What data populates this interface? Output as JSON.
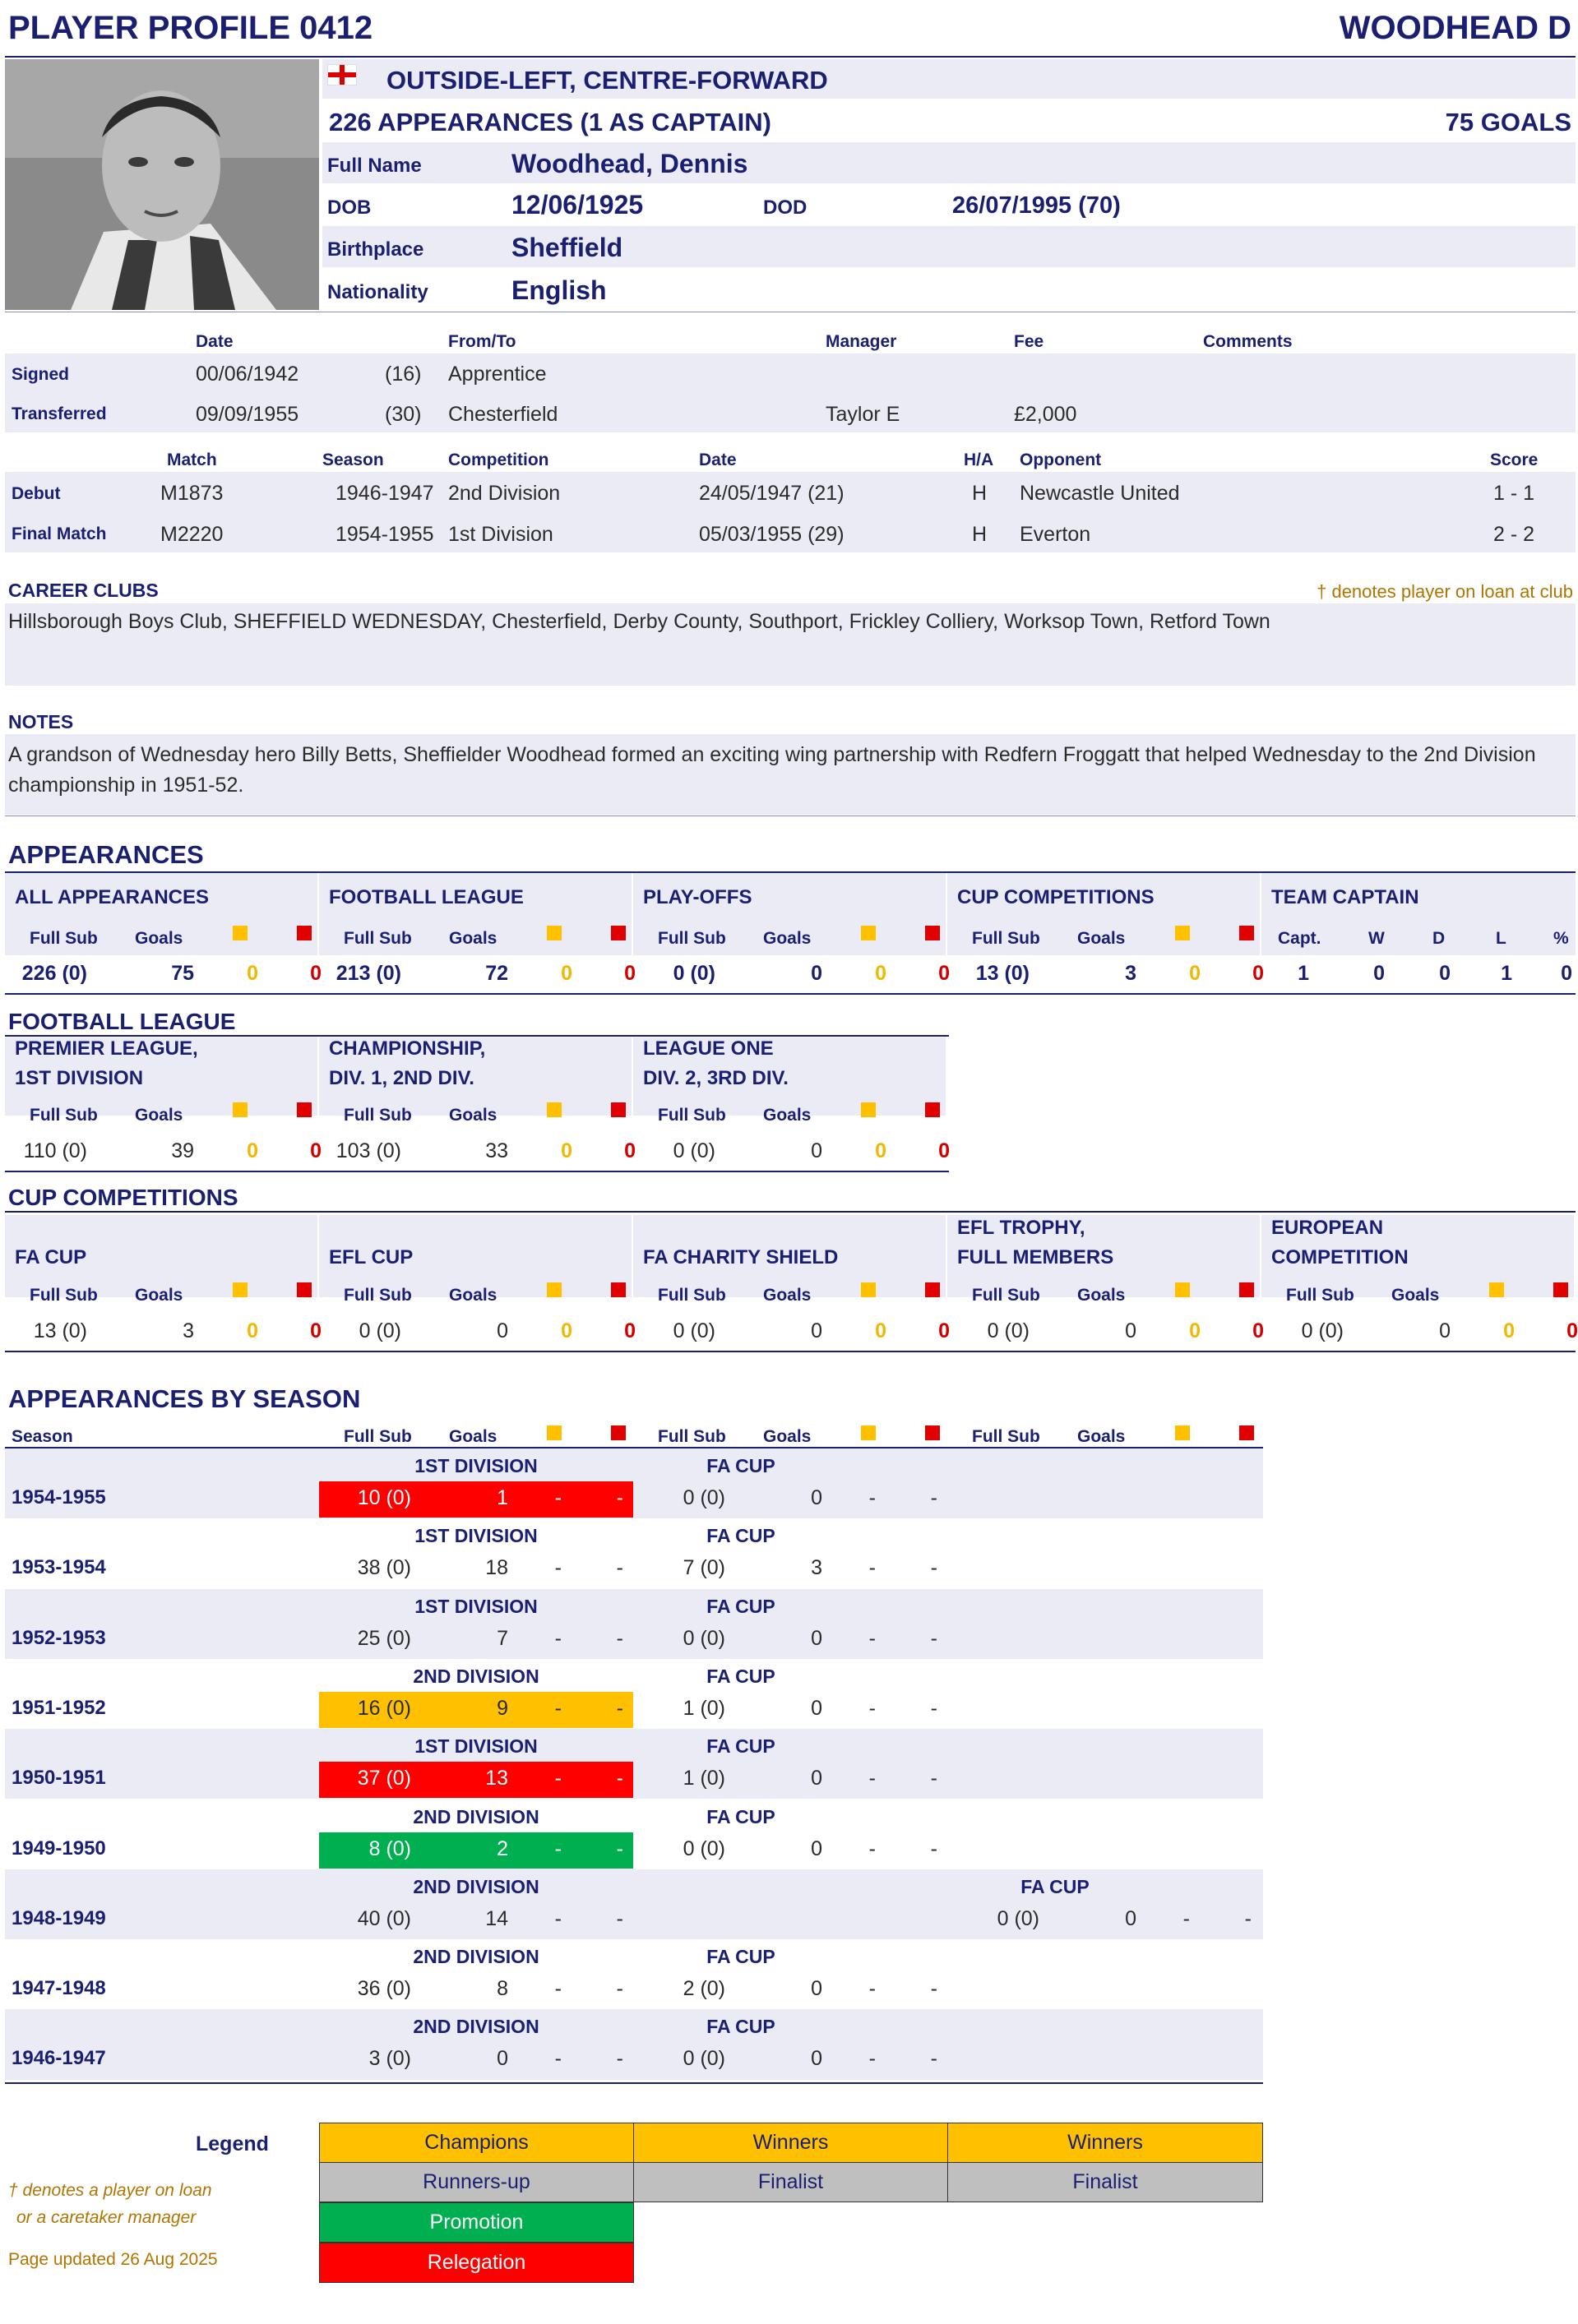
{
  "header": {
    "title": "PLAYER PROFILE 0412",
    "name": "WOODHEAD D"
  },
  "profile": {
    "position": "OUTSIDE-LEFT, CENTRE-FORWARD",
    "appearances": "226 APPEARANCES (1 AS CAPTAIN)",
    "goals": "75 GOALS",
    "full_name_label": "Full Name",
    "full_name": "Woodhead, Dennis",
    "dob_label": "DOB",
    "dob": "12/06/1925",
    "dod_label": "DOD",
    "dod": "26/07/1995 (70)",
    "birthplace_label": "Birthplace",
    "birthplace": "Sheffield",
    "nationality_label": "Nationality",
    "nationality": "English"
  },
  "transfers": {
    "headers": [
      "Date",
      "From/To",
      "Manager",
      "Fee",
      "Comments"
    ],
    "rows": [
      {
        "label": "Signed",
        "date": "00/06/1942",
        "age": "(16)",
        "fromto": "Apprentice",
        "manager": "",
        "fee": ""
      },
      {
        "label": "Transferred",
        "date": "09/09/1955",
        "age": "(30)",
        "fromto": "Chesterfield",
        "manager": "Taylor E",
        "fee": "£2,000"
      }
    ]
  },
  "matches": {
    "headers": [
      "Match",
      "Season",
      "Competition",
      "Date",
      "H/A",
      "Opponent",
      "Score"
    ],
    "rows": [
      {
        "label": "Debut",
        "match": "M1873",
        "season": "1946-1947",
        "comp": "2nd Division",
        "date": "24/05/1947 (21)",
        "ha": "H",
        "opp": "Newcastle United",
        "score": "1 - 1"
      },
      {
        "label": "Final Match",
        "match": "M2220",
        "season": "1954-1955",
        "comp": "1st Division",
        "date": "05/03/1955 (29)",
        "ha": "H",
        "opp": "Everton",
        "score": "2 - 2"
      }
    ]
  },
  "career": {
    "title": "CAREER CLUBS",
    "loan_note": "† denotes player on loan at club",
    "clubs": "Hillsborough Boys Club, SHEFFIELD WEDNESDAY, Chesterfield, Derby County, Southport, Frickley Colliery, Worksop Town, Retford Town"
  },
  "notes": {
    "title": "NOTES",
    "text": "A grandson of Wednesday hero Billy Betts, Sheffielder Woodhead formed an exciting wing partnership with Redfern Froggatt that helped Wednesday to the 2nd Division championship in 1951-52."
  },
  "appearances": {
    "title": "APPEARANCES",
    "cols": {
      "full_sub": "Full Sub",
      "goals": "Goals",
      "capt": "Capt.",
      "w": "W",
      "d": "D",
      "l": "L",
      "pct": "%"
    },
    "blocks": [
      {
        "title": "ALL APPEARANCES",
        "apps": "226 (0)",
        "goals": "75",
        "y": "0",
        "r": "0"
      },
      {
        "title": "FOOTBALL LEAGUE",
        "apps": "213 (0)",
        "goals": "72",
        "y": "0",
        "r": "0"
      },
      {
        "title": "PLAY-OFFS",
        "apps": "0 (0)",
        "goals": "0",
        "y": "0",
        "r": "0"
      },
      {
        "title": "CUP COMPETITIONS",
        "apps": "13 (0)",
        "goals": "3",
        "y": "0",
        "r": "0"
      }
    ],
    "captain": {
      "title": "TEAM CAPTAIN",
      "capt": "1",
      "w": "0",
      "d": "0",
      "l": "1",
      "pct": "0"
    }
  },
  "league": {
    "title": "FOOTBALL LEAGUE",
    "blocks": [
      {
        "t1": "PREMIER LEAGUE,",
        "t2": "1ST DIVISION",
        "apps": "110 (0)",
        "goals": "39",
        "y": "0",
        "r": "0"
      },
      {
        "t1": "CHAMPIONSHIP,",
        "t2": "DIV. 1, 2ND DIV.",
        "apps": "103 (0)",
        "goals": "33",
        "y": "0",
        "r": "0"
      },
      {
        "t1": "LEAGUE ONE",
        "t2": "DIV. 2, 3RD DIV.",
        "apps": "0 (0)",
        "goals": "0",
        "y": "0",
        "r": "0"
      }
    ]
  },
  "cups": {
    "title": "CUP COMPETITIONS",
    "blocks": [
      {
        "t1": "",
        "t2": "FA CUP",
        "apps": "13 (0)",
        "goals": "3",
        "y": "0",
        "r": "0"
      },
      {
        "t1": "",
        "t2": "EFL CUP",
        "apps": "0 (0)",
        "goals": "0",
        "y": "0",
        "r": "0"
      },
      {
        "t1": "",
        "t2": "FA CHARITY SHIELD",
        "apps": "0 (0)",
        "goals": "0",
        "y": "0",
        "r": "0"
      },
      {
        "t1": "EFL TROPHY,",
        "t2": "FULL MEMBERS",
        "apps": "0 (0)",
        "goals": "0",
        "y": "0",
        "r": "0"
      },
      {
        "t1": "EUROPEAN",
        "t2": "COMPETITION",
        "apps": "0 (0)",
        "goals": "0",
        "y": "0",
        "r": "0"
      }
    ]
  },
  "by_season": {
    "title": "APPEARANCES BY SEASON",
    "season_label": "Season",
    "rows": [
      {
        "season": "1954-1955",
        "c1": "1ST DIVISION",
        "a1": "10 (0)",
        "g1": "1",
        "y1": "-",
        "r1": "-",
        "hl": "relegation",
        "c2": "FA CUP",
        "a2": "0 (0)",
        "g2": "0",
        "y2": "-",
        "r2": "-",
        "col2": 1
      },
      {
        "season": "1953-1954",
        "c1": "1ST DIVISION",
        "a1": "38 (0)",
        "g1": "18",
        "y1": "-",
        "r1": "-",
        "hl": "",
        "c2": "FA CUP",
        "a2": "7 (0)",
        "g2": "3",
        "y2": "-",
        "r2": "-",
        "col2": 1
      },
      {
        "season": "1952-1953",
        "c1": "1ST DIVISION",
        "a1": "25 (0)",
        "g1": "7",
        "y1": "-",
        "r1": "-",
        "hl": "",
        "c2": "FA CUP",
        "a2": "0 (0)",
        "g2": "0",
        "y2": "-",
        "r2": "-",
        "col2": 1
      },
      {
        "season": "1951-1952",
        "c1": "2ND DIVISION",
        "a1": "16 (0)",
        "g1": "9",
        "y1": "-",
        "r1": "-",
        "hl": "champions",
        "c2": "FA CUP",
        "a2": "1 (0)",
        "g2": "0",
        "y2": "-",
        "r2": "-",
        "col2": 1
      },
      {
        "season": "1950-1951",
        "c1": "1ST DIVISION",
        "a1": "37 (0)",
        "g1": "13",
        "y1": "-",
        "r1": "-",
        "hl": "relegation",
        "c2": "FA CUP",
        "a2": "1 (0)",
        "g2": "0",
        "y2": "-",
        "r2": "-",
        "col2": 1
      },
      {
        "season": "1949-1950",
        "c1": "2ND DIVISION",
        "a1": "8 (0)",
        "g1": "2",
        "y1": "-",
        "r1": "-",
        "hl": "promotion",
        "c2": "FA CUP",
        "a2": "0 (0)",
        "g2": "0",
        "y2": "-",
        "r2": "-",
        "col2": 1
      },
      {
        "season": "1948-1949",
        "c1": "2ND DIVISION",
        "a1": "40 (0)",
        "g1": "14",
        "y1": "-",
        "r1": "-",
        "hl": "",
        "c2": "FA CUP",
        "a2": "0 (0)",
        "g2": "0",
        "y2": "-",
        "r2": "-",
        "col2": 2
      },
      {
        "season": "1947-1948",
        "c1": "2ND DIVISION",
        "a1": "36 (0)",
        "g1": "8",
        "y1": "-",
        "r1": "-",
        "hl": "",
        "c2": "FA CUP",
        "a2": "2 (0)",
        "g2": "0",
        "y2": "-",
        "r2": "-",
        "col2": 1
      },
      {
        "season": "1946-1947",
        "c1": "2ND DIVISION",
        "a1": "3 (0)",
        "g1": "0",
        "y1": "-",
        "r1": "-",
        "hl": "",
        "c2": "FA CUP",
        "a2": "0 (0)",
        "g2": "0",
        "y2": "-",
        "r2": "-",
        "col2": 1
      }
    ]
  },
  "legend": {
    "title": "Legend",
    "champions": "Champions",
    "winners": "Winners",
    "runners_up": "Runners-up",
    "finalist": "Finalist",
    "promotion": "Promotion",
    "relegation": "Relegation",
    "note1": "† denotes a player on loan",
    "note2": "or a caretaker manager",
    "updated": "Page updated 26 Aug 2025"
  },
  "colors": {
    "navy": "#1a1f71",
    "champions": "#ffc000",
    "runners_up": "#bfbfbf",
    "promotion": "#00b050",
    "relegation": "#ff0000"
  }
}
